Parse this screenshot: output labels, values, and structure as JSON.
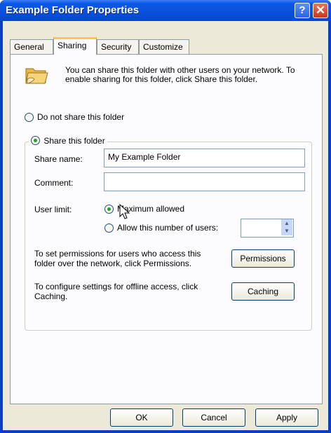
{
  "window": {
    "title": "Example Folder Properties"
  },
  "titlebar": {
    "help_label": "?",
    "close_label": "✕"
  },
  "tabs": [
    {
      "label": "General"
    },
    {
      "label": "Sharing"
    },
    {
      "label": "Security"
    },
    {
      "label": "Customize"
    }
  ],
  "intro_text": "You can share this folder with other users on your network.  To enable sharing for this folder, click Share this folder.",
  "do_not_share_label": "Do not share this folder",
  "share_label": "Share this folder",
  "share_name": {
    "label": "Share name:",
    "value": "My Example Folder"
  },
  "comment": {
    "label": "Comment:",
    "value": ""
  },
  "user_limit": {
    "label": "User limit:",
    "max_allowed_label": "Maximum allowed",
    "allow_number_label": "Allow this number of users:",
    "number_value": ""
  },
  "permissions_text": "To set permissions for users who access this folder over the network, click Permissions.",
  "permissions_button": "Permissions",
  "caching_text": "To configure settings for offline access, click Caching.",
  "caching_button": "Caching",
  "buttons": {
    "ok": "OK",
    "cancel": "Cancel",
    "apply": "Apply"
  },
  "colors": {
    "title_blue": "#0a4fdc",
    "radio_green": "#21a121",
    "tab_highlight": "#ffc83c"
  },
  "icons": {
    "folder": "shared-folder-icon",
    "cursor": "mouse-pointer-icon"
  }
}
